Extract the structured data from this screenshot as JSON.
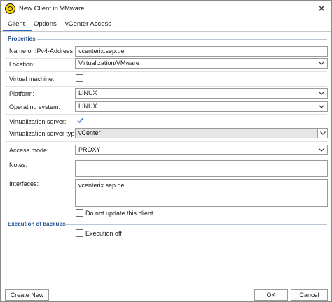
{
  "window": {
    "title": "New Client in VMware",
    "close_glyph": "✕"
  },
  "tabs": [
    {
      "label": "Client",
      "active": true
    },
    {
      "label": "Options",
      "active": false
    },
    {
      "label": "vCenter Access",
      "active": false
    }
  ],
  "properties": {
    "section_title": "Properties",
    "name_label": "Name or IPv4-Address:",
    "name_value": "vcenterix.sep.de",
    "location_label": "Location:",
    "location_value": "Virtualization/VMware",
    "virtual_machine_label": "Virtual machine:",
    "virtual_machine_checked": false,
    "platform_label": "Platform:",
    "platform_value": "LINUX",
    "os_label": "Operating system:",
    "os_value": "LINUX",
    "virt_server_label": "Virtualization server:",
    "virt_server_checked": true,
    "virt_server_type_label": "Virtualization server type:",
    "virt_server_type_value": "vCenter",
    "access_mode_label": "Access mode:",
    "access_mode_value": "PROXY",
    "notes_label": "Notes:",
    "notes_value": "",
    "interfaces_label": "Interfaces:",
    "interfaces_value": "vcenterix.sep.de",
    "do_not_update_label": "Do not update this client",
    "do_not_update_checked": false
  },
  "execution": {
    "section_title": "Execution of backups",
    "execution_off_label": "Execution off",
    "execution_off_checked": false
  },
  "buttons": {
    "create_new": "Create New",
    "ok": "OK",
    "cancel": "Cancel"
  },
  "colors": {
    "accent": "#2a6ab8",
    "section_title": "#1f4f8f",
    "app_icon": "#f3d000"
  },
  "icons": {
    "app": "sep-logo-icon",
    "close": "close-icon",
    "dropdown": "chevron-down-icon",
    "check": "check-icon"
  }
}
